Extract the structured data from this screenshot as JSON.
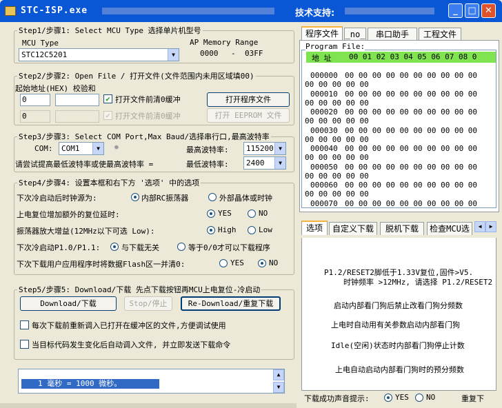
{
  "window": {
    "title": "STC-ISP.exe",
    "support_label": "技术支持:",
    "colors": {
      "titlebar": "#0a57d6",
      "panel": "#ece9d8",
      "status_bar": "#3167c4",
      "hex_header": "#7fe44f"
    }
  },
  "step1": {
    "legend": "Step1/步骤1: Select MCU Type  选择单片机型号",
    "mcu_type_label": "MCU Type",
    "mcu_type_value": "STC12C5201",
    "ap_label": "AP Memory Range",
    "ap_start": "0000",
    "ap_sep": "-",
    "ap_end": "03FF"
  },
  "step2": {
    "legend": "Step2/步骤2: Open File / 打开文件(文件范围内未用区域填00)",
    "start_addr_label": "起始地址(HEX) 校验和",
    "addr1": "0",
    "checksum1": "",
    "addr2": "0",
    "checksum2": "",
    "clear_buf1_label": "打开文件前清0缓冲",
    "clear_buf2_label": "打开文件前清0缓冲",
    "open_prog_btn": "打开程序文件",
    "open_eeprom_btn": "打开 EEPROM 文件"
  },
  "step3": {
    "legend": "Step3/步骤3: Select COM Port,Max Baud/选择串行口,最高波特率",
    "com_label": "COM:",
    "com_value": "COM1",
    "max_baud_label": "最高波特率:",
    "max_baud_value": "115200",
    "hint_text": "请尝试提高最低波特率或使最高波特率 =",
    "min_baud_label": "最低波特率:",
    "min_baud_value": "2400"
  },
  "step4": {
    "legend": "Step4/步骤4: 设置本框和右下方 '选项' 中的选项",
    "rows": [
      {
        "label": "下次冷启动后时钟源为:",
        "opt1": "内部RC振荡器",
        "opt2": "外部晶体或时钟",
        "selected": 1
      },
      {
        "label": "上电复位增加额外的复位延时:",
        "opt1": "YES",
        "opt2": "NO",
        "selected": 1
      },
      {
        "label": "振荡器放大增益(12MHz以下可选 Low):",
        "opt1": "High",
        "opt2": "Low",
        "selected": 1
      },
      {
        "label": "下次冷启动P1.0/P1.1:",
        "opt1": "与下载无关",
        "opt2": "等于0/0才可以下载程序",
        "selected": 1
      },
      {
        "label": "下次下载用户应用程序时将数据Flash区一并清0:",
        "opt1": "YES",
        "opt2": "NO",
        "selected": 2
      }
    ]
  },
  "step5": {
    "legend": "Step5/步骤5: Download/下载  先点下载按钮再MCU上电复位-冷启动",
    "download_btn": "Download/下载",
    "stop_btn": "Stop/停止",
    "redownload_btn": "Re-Download/重复下载",
    "reload_label": "每次下载前重新调入已打开在缓冲区的文件,方便调试使用",
    "autoload_label": "当目标代码发生变化后自动调入文件, 并立即发送下载命令"
  },
  "log": {
    "line": "1 毫秒 = 1000 微秒。"
  },
  "right_tabs": [
    {
      "label": "程序文件"
    },
    {
      "label": "_no_"
    },
    {
      "label": "串口助手"
    },
    {
      "label": "工程文件"
    }
  ],
  "program_file_label": "Program File:",
  "hex": {
    "header_addr": "地 址",
    "header_cols": "00 01 02 03 04 05 06 07 08 0",
    "rows": [
      {
        "addr": "000000",
        "line1": "00 00 00 00 00 00 00 00 00 00",
        "line2": "00 00 00 00 00"
      },
      {
        "addr": "000010",
        "line1": "00 00 00 00 00 00 00 00 00 00",
        "line2": "00 00 00 00 00"
      },
      {
        "addr": "000020",
        "line1": "00 00 00 00 00 00 00 00 00 00",
        "line2": "00 00 00 00 00"
      },
      {
        "addr": "000030",
        "line1": "00 00 00 00 00 00 00 00 00 00",
        "line2": "00 00 00 00 00"
      },
      {
        "addr": "000040",
        "line1": "00 00 00 00 00 00 00 00 00 00",
        "line2": "00 00 00 00 00"
      },
      {
        "addr": "000050",
        "line1": "00 00 00 00 00 00 00 00 00 00",
        "line2": "00 00 00 00 00"
      },
      {
        "addr": "000060",
        "line1": "00 00 00 00 00 00 00 00 00 00",
        "line2": "00 00 00 00 00"
      },
      {
        "addr": "000070",
        "line1": "00 00 00 00 00 00 00 00 00 00",
        "line2": ""
      }
    ]
  },
  "option_tabs": [
    {
      "label": "选项"
    },
    {
      "label": "自定义下载"
    },
    {
      "label": "脱机下载"
    },
    {
      "label": "检查MCU选"
    }
  ],
  "options_text": [
    "P1.2/RESET2脚低于1.33V复位,固件>V5.",
    "时钟频率 >12MHz, 请选择 P1.2/RESET2",
    "启动内部看门狗后禁止改看门狗分频数",
    "上电时自动用有关参数启动内部看门狗",
    "Idle(空闲)状态时内部看门狗停止计数",
    "上电自动启动内部看门狗时的预分频数"
  ],
  "sound": {
    "label": "下载成功声音提示:",
    "yes": "YES",
    "no": "NO",
    "selected": 1,
    "redownload": "重复下"
  }
}
